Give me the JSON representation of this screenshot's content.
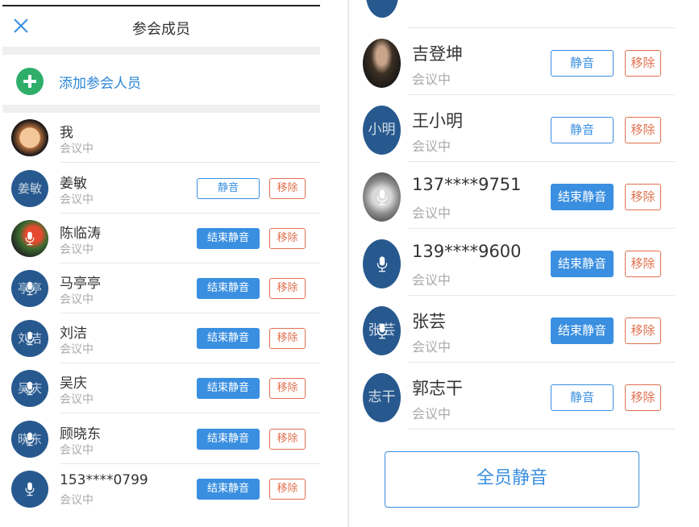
{
  "left": {
    "title": "参会成员",
    "add_label": "添加参会人员",
    "members": [
      {
        "name": "我",
        "status": "会议中",
        "avatar_text": "",
        "avatar_style": "moon",
        "mic": false,
        "mute_label": "",
        "remove_label": ""
      },
      {
        "name": "姜敏",
        "status": "会议中",
        "avatar_text": "姜敏",
        "avatar_style": "blue",
        "mic": false,
        "mute_label": "静音",
        "mute_state": "mute",
        "remove_label": "移除"
      },
      {
        "name": "陈临涛",
        "status": "会议中",
        "avatar_text": "",
        "avatar_style": "photo",
        "mic": true,
        "mute_label": "结束静音",
        "mute_state": "unmute",
        "remove_label": "移除"
      },
      {
        "name": "马亭亭",
        "status": "会议中",
        "avatar_text": "亭亭",
        "avatar_style": "blue",
        "mic": true,
        "mute_label": "结束静音",
        "mute_state": "unmute",
        "remove_label": "移除"
      },
      {
        "name": "刘洁",
        "status": "会议中",
        "avatar_text": "刘洁",
        "avatar_style": "blue",
        "mic": true,
        "mute_label": "结束静音",
        "mute_state": "unmute",
        "remove_label": "移除"
      },
      {
        "name": "吴庆",
        "status": "会议中",
        "avatar_text": "吴庆",
        "avatar_style": "blue",
        "mic": true,
        "mute_label": "结束静音",
        "mute_state": "unmute",
        "remove_label": "移除"
      },
      {
        "name": "顾晓东",
        "status": "会议中",
        "avatar_text": "晓东",
        "avatar_style": "blue",
        "mic": true,
        "mute_label": "结束静音",
        "mute_state": "unmute",
        "remove_label": "移除"
      },
      {
        "name": "153****0799",
        "status": "会议中",
        "avatar_text": "",
        "avatar_style": "blue",
        "mic": true,
        "mute_label": "结束静音",
        "mute_state": "unmute",
        "remove_label": "移除"
      }
    ]
  },
  "right": {
    "members": [
      {
        "name": "吉登坤",
        "status": "会议中",
        "avatar_text": "",
        "avatar_style": "photo",
        "mic": false,
        "mute_label": "静音",
        "mute_state": "mute",
        "remove_label": "移除"
      },
      {
        "name": "王小明",
        "status": "会议中",
        "avatar_text": "小明",
        "avatar_style": "blue",
        "mic": false,
        "mute_label": "静音",
        "mute_state": "mute",
        "remove_label": "移除"
      },
      {
        "name": "137****9751",
        "status": "会议中",
        "avatar_text": "",
        "avatar_style": "gray",
        "mic": true,
        "mute_label": "结束静音",
        "mute_state": "unmute",
        "remove_label": "移除"
      },
      {
        "name": "139****9600",
        "status": "会议中",
        "avatar_text": "",
        "avatar_style": "blue",
        "mic": true,
        "mute_label": "结束静音",
        "mute_state": "unmute",
        "remove_label": "移除"
      },
      {
        "name": "张芸",
        "status": "会议中",
        "avatar_text": "张芸",
        "avatar_style": "blue",
        "mic": true,
        "mute_label": "结束静音",
        "mute_state": "unmute",
        "remove_label": "移除"
      },
      {
        "name": "郭志干",
        "status": "会议中",
        "avatar_text": "志干",
        "avatar_style": "blue",
        "mic": false,
        "mute_label": "静音",
        "mute_state": "mute",
        "remove_label": "移除"
      }
    ],
    "mute_all_label": "全员静音"
  },
  "colors": {
    "accent_blue": "#3a8fe0",
    "remove_red": "#e0704e",
    "add_green": "#2fae6a",
    "avatar_blue": "#27598f"
  },
  "icons": [
    "close-icon",
    "add-icon",
    "mic-icon"
  ]
}
